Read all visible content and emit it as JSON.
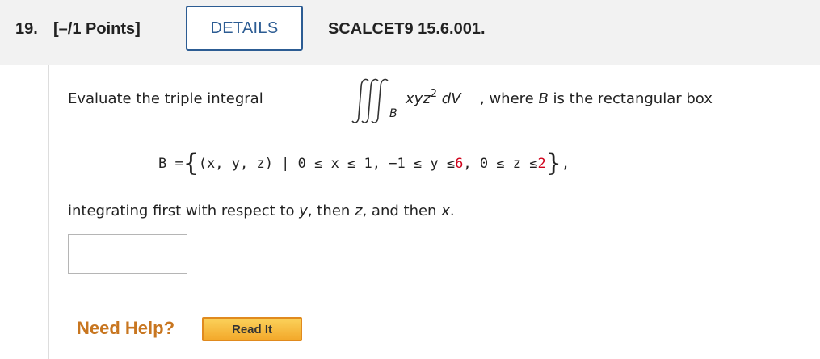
{
  "header": {
    "question_number": "19.",
    "points": "[–/1 Points]",
    "details_label": "DETAILS",
    "question_id": "SCALCET9 15.6.001."
  },
  "problem": {
    "intro": "Evaluate the triple integral",
    "integral_region": "B",
    "integrand_vars": "xyz",
    "integrand_exp": "2",
    "differential": " dV",
    "after_integral": ", where ",
    "box_var": "B",
    "after_box": " is the rectangular box",
    "set_lhs": "B = ",
    "set_body": "(x, y, z) | 0 ≤ x ≤ 1, −1 ≤ y ≤ ",
    "y_upper": "6",
    "set_mid": ", 0 ≤ z ≤ ",
    "z_upper": "2",
    "set_end": ",",
    "instruction_a": "integrating first with respect to ",
    "var_y": "y",
    "instruction_b": ", then ",
    "var_z": "z",
    "instruction_c": ", and then ",
    "var_x": "x",
    "instruction_d": ".",
    "highlight_color": "#d0021b"
  },
  "answer": {
    "value": ""
  },
  "help": {
    "label": "Need Help?",
    "read_it_label": "Read It"
  }
}
